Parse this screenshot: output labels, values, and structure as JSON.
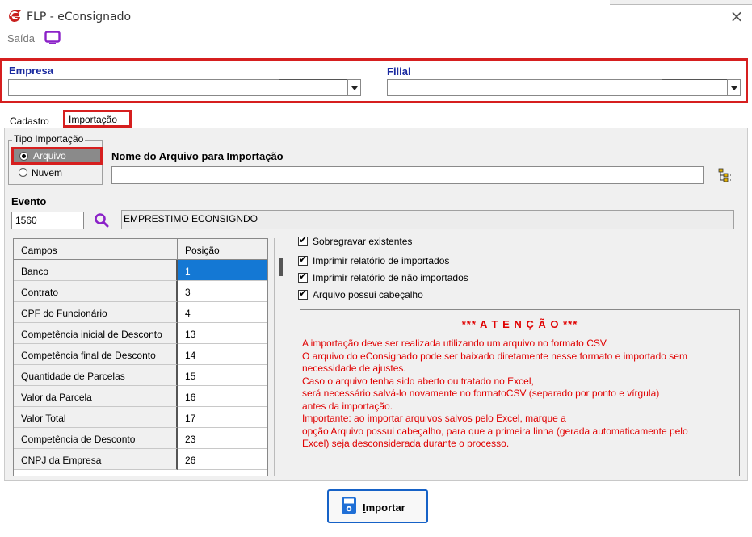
{
  "window": {
    "title": "FLP - eConsignado",
    "close_glyph": "×"
  },
  "toolbar": {
    "saida_label": "Saída"
  },
  "empresa_group": {
    "empresa_label": "Empresa",
    "filial_label": "Filial"
  },
  "tabs": [
    {
      "label": "Cadastro",
      "active": false
    },
    {
      "label": "Importação",
      "active": true
    }
  ],
  "tipo_importacao": {
    "title": "Tipo Importação",
    "options": [
      {
        "label": "Arquivo",
        "selected": true
      },
      {
        "label": "Nuvem",
        "selected": false
      }
    ]
  },
  "arquivo": {
    "label": "Nome do Arquivo para Importação",
    "value": ""
  },
  "evento": {
    "label": "Evento",
    "code": "1560",
    "description": "EMPRESTIMO ECONSIGNDO"
  },
  "grid": {
    "headers": [
      "Campos",
      "Posição"
    ],
    "rows": [
      {
        "campo": "Banco",
        "posicao": "1",
        "selected": true
      },
      {
        "campo": "Contrato",
        "posicao": "3"
      },
      {
        "campo": "CPF do Funcionário",
        "posicao": "4"
      },
      {
        "campo": "Competência inicial de Desconto",
        "posicao": "13"
      },
      {
        "campo": "Competência final de Desconto",
        "posicao": "14"
      },
      {
        "campo": "Quantidade de Parcelas",
        "posicao": "15"
      },
      {
        "campo": "Valor da Parcela",
        "posicao": "16"
      },
      {
        "campo": "Valor Total",
        "posicao": "17"
      },
      {
        "campo": "Competência de Desconto",
        "posicao": "23"
      },
      {
        "campo": "CNPJ da Empresa",
        "posicao": "26"
      }
    ]
  },
  "options": [
    {
      "label": "Sobregravar existentes",
      "checked": true
    },
    {
      "label": "Imprimir relatório de importados",
      "checked": true
    },
    {
      "label": "Imprimir relatório de não importados",
      "checked": true
    },
    {
      "label": "Arquivo possui cabeçalho",
      "checked": true
    }
  ],
  "atencao": {
    "title": "*** A T E N Ç Ã O ***",
    "lines": [
      "A importação deve ser realizada utilizando um arquivo no formato CSV.",
      "O arquivo do eConsignado pode ser baixado diretamente nesse formato e importado sem",
      "necessidade de ajustes.",
      "Caso o arquivo tenha sido aberto ou tratado no Excel,",
      "será necessário salvá-lo novamente no formatoCSV (separado por ponto e vírgula)",
      "antes da importação.",
      "Importante: ao importar arquivos salvos pelo Excel, marque a",
      "opção Arquivo possui cabeçalho, para que a primeira linha (gerada automaticamente pelo",
      "Excel) seja desconsiderada durante o processo."
    ],
    "color": "#e00000"
  },
  "actions": {
    "importar_label": "Importar"
  },
  "icons": {
    "logo": "app-logo-icon",
    "monitor": "monitor-icon",
    "tree": "tree-browse-icon",
    "search": "search-icon",
    "save": "floppy-disk-icon"
  },
  "colors": {
    "highlight": "#d61f1f",
    "label_blue": "#1a2aa0",
    "selection": "#1478d4",
    "accent_purple": "#8b22c8"
  }
}
